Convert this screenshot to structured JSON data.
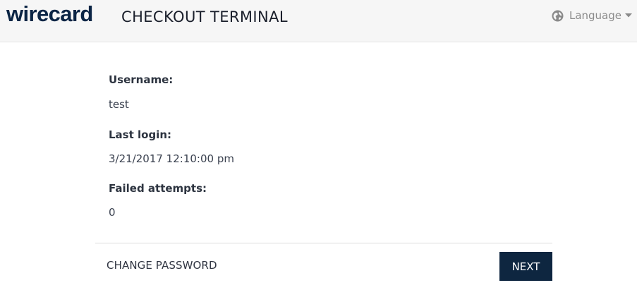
{
  "header": {
    "logo_text": "wirecard",
    "app_title": "CHECKOUT TERMINAL",
    "language_label": "Language",
    "globe_icon": "globe-icon",
    "caret_icon": "caret-down-icon"
  },
  "account": {
    "username_label": "Username:",
    "username_value": "test",
    "last_login_label": "Last login:",
    "last_login_value": "3/21/2017 12:10:00 pm",
    "failed_attempts_label": "Failed attempts:",
    "failed_attempts_value": "0"
  },
  "actions": {
    "change_password_label": "CHANGE PASSWORD",
    "next_label": "NEXT"
  },
  "colors": {
    "brand_navy": "#0e2640",
    "header_bg": "#f6f6f6"
  }
}
